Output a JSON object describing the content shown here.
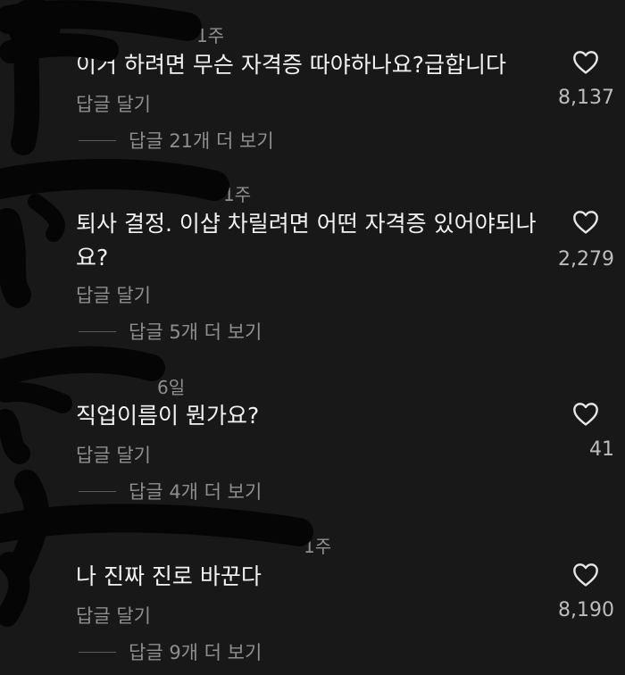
{
  "reply_label": "답글 달기",
  "comments": [
    {
      "time": "1주",
      "text": "이거 하려면 무슨 자격증 따야하나요?급합니다",
      "likes": "8,137",
      "more_replies": "답글 21개 더 보기"
    },
    {
      "time": "1주",
      "text": "퇴사 결정. 이샵 차릴려면 어떤 자격증 있어야되나요?",
      "likes": "2,279",
      "more_replies": "답글 5개 더 보기"
    },
    {
      "time": "6일",
      "text": "직업이름이 뭔가요?",
      "likes": "41",
      "more_replies": "답글 4개 더 보기"
    },
    {
      "time": "1주",
      "text": "나 진짜 진로 바꾼다",
      "likes": "8,190",
      "more_replies": "답글 9개 더 보기"
    }
  ],
  "colors": {
    "background": "#181818",
    "text": "#f2f2f2",
    "muted": "#8e8e8e",
    "redaction": "#050505"
  },
  "icons": {
    "like": "heart-outline-icon"
  }
}
